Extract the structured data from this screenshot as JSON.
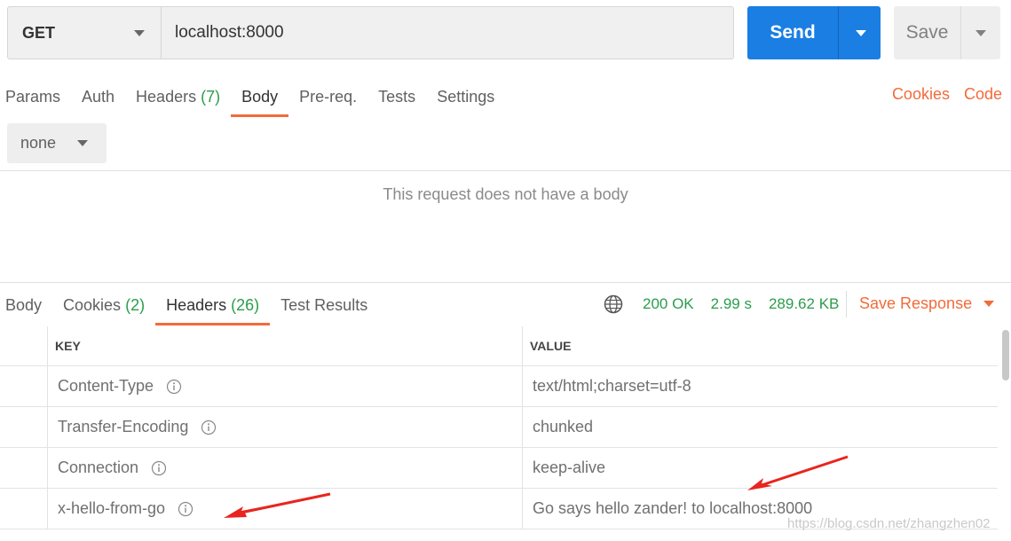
{
  "request": {
    "method": "GET",
    "url": "localhost:8000",
    "send_label": "Send",
    "save_label": "Save"
  },
  "request_tabs": [
    {
      "label": "Params",
      "count": ""
    },
    {
      "label": "Auth",
      "count": ""
    },
    {
      "label": "Headers",
      "count": "(7)"
    },
    {
      "label": "Body",
      "count": ""
    },
    {
      "label": "Pre-req.",
      "count": ""
    },
    {
      "label": "Tests",
      "count": ""
    },
    {
      "label": "Settings",
      "count": ""
    }
  ],
  "links": {
    "cookies": "Cookies",
    "code": "Code"
  },
  "body_type": "none",
  "no_body_message": "This request does not have a body",
  "response_tabs": [
    {
      "label": "Body",
      "count": ""
    },
    {
      "label": "Cookies",
      "count": "(2)"
    },
    {
      "label": "Headers",
      "count": "(26)"
    },
    {
      "label": "Test Results",
      "count": ""
    }
  ],
  "status": {
    "code": "200 OK",
    "time": "2.99 s",
    "size": "289.62 KB"
  },
  "save_response_label": "Save Response",
  "table": {
    "key_header": "KEY",
    "value_header": "VALUE",
    "rows": [
      {
        "key": "Content-Type",
        "value": "text/html;charset=utf-8"
      },
      {
        "key": "Transfer-Encoding",
        "value": "chunked"
      },
      {
        "key": "Connection",
        "value": "keep-alive"
      },
      {
        "key": "x-hello-from-go",
        "value": "Go says hello zander! to localhost:8000"
      }
    ]
  },
  "watermark": "https://blog.csdn.net/zhangzhen02",
  "colors": {
    "accent": "#f26b3a",
    "send": "#1a7ee3",
    "success": "#2a9d4b",
    "annotation_arrow": "#e8251f"
  }
}
